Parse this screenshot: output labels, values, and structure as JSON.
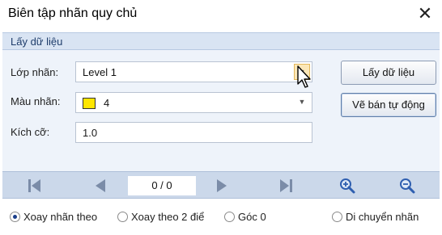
{
  "window": {
    "title": "Biên tập nhãn quy chủ",
    "close_glyph": "✕"
  },
  "section": {
    "title": "Lấy dữ liệu"
  },
  "form": {
    "layer_label": "Lớp nhãn:",
    "layer_value": "Level 1",
    "color_label": "Màu nhãn:",
    "color_value": "4",
    "color_swatch": "#ffe600",
    "size_label": "Kích cỡ:",
    "size_value": "1.0"
  },
  "buttons": {
    "get_data": "Lấy dữ liệu",
    "auto_draw": "Vẽ bán tự động"
  },
  "navigation": {
    "page_indicator": "0 / 0",
    "icons": [
      "first-page-icon",
      "previous-icon",
      "next-icon",
      "last-page-icon",
      "zoom-in-icon",
      "zoom-out-icon"
    ]
  },
  "options": {
    "rotate_label": "Xoay nhãn theo",
    "rotate_two_points": "Xoay theo 2 điể",
    "angle_zero": "Góc 0",
    "move_label": "Di chuyển nhãn",
    "selected": "rotate_label"
  },
  "colors": {
    "accent": "#1f4e9a",
    "section_bg": "#d9e4f3",
    "nav_bg": "#cbd8ea"
  }
}
